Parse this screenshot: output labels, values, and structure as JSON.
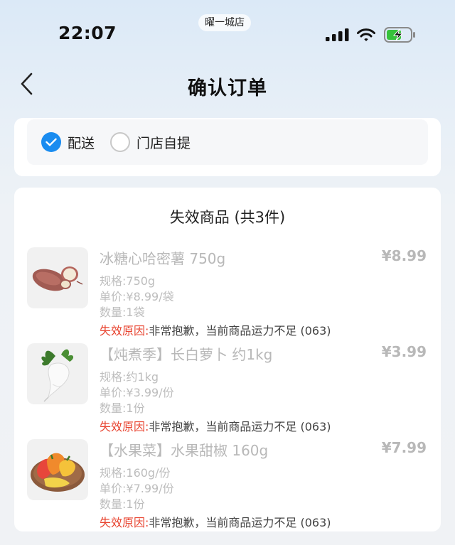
{
  "status_bar": {
    "time": "22:07",
    "store": "曜一城店"
  },
  "header": {
    "title": "确认订单",
    "back_icon": "chevron-left-icon"
  },
  "delivery": {
    "options": [
      {
        "label": "配送",
        "selected": true
      },
      {
        "label": "门店自提",
        "selected": false
      }
    ],
    "accent_color": "#1a8cf0"
  },
  "invalid_goods": {
    "title": "失效商品 (共3件)",
    "items": [
      {
        "name": "冰糖心哈密薯 750g",
        "price": "¥8.99",
        "spec": "规格:750g",
        "unit_price": "单价:¥8.99/袋",
        "quantity": "数量:1袋",
        "reason_label": "失效原因:",
        "reason_text": "非常抱歉，当前商品运力不足 (063)",
        "image": "sweet-potato-image"
      },
      {
        "name": "【炖煮季】长白萝卜 约1kg",
        "price": "¥3.99",
        "spec": "规格:约1kg",
        "unit_price": "单价:¥3.99/份",
        "quantity": "数量:1份",
        "reason_label": "失效原因:",
        "reason_text": "非常抱歉，当前商品运力不足 (063)",
        "image": "white-radish-image"
      },
      {
        "name": "【水果菜】水果甜椒 160g",
        "price": "¥7.99",
        "spec": "规格:160g/份",
        "unit_price": "单价:¥7.99/份",
        "quantity": "数量:1份",
        "reason_label": "失效原因:",
        "reason_text": "非常抱歉，当前商品运力不足 (063)",
        "image": "sweet-pepper-image"
      }
    ],
    "reason_color": "#e8432f"
  }
}
